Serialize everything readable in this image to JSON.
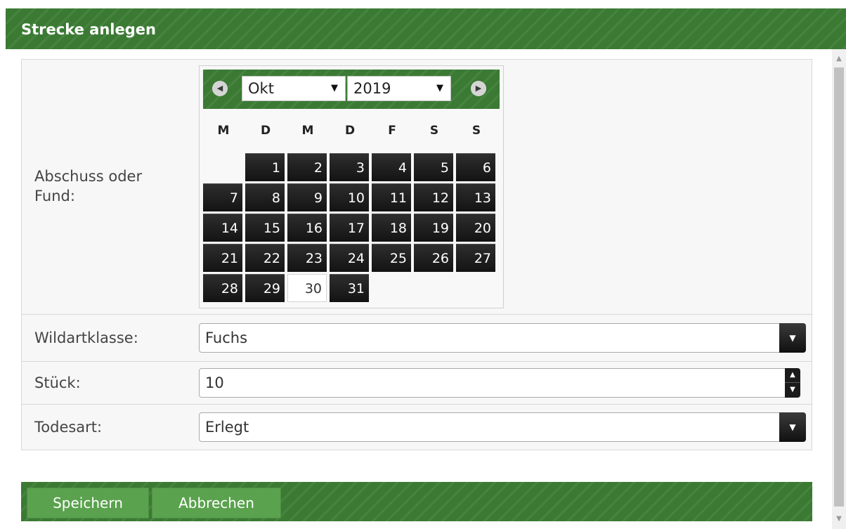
{
  "header": {
    "title": "Strecke anlegen"
  },
  "form": {
    "date_label": "Abschuss oder Fund:",
    "species_label": "Wildartklasse:",
    "species_value": "Fuchs",
    "count_label": "Stück:",
    "count_value": "10",
    "death_label": "Todesart:",
    "death_value": "Erlegt"
  },
  "calendar": {
    "month": "Okt",
    "year": "2019",
    "weekdays": [
      "M",
      "D",
      "M",
      "D",
      "F",
      "S",
      "S"
    ],
    "first_weekday_offset": 1,
    "days": [
      "1",
      "2",
      "3",
      "4",
      "5",
      "6",
      "7",
      "8",
      "9",
      "10",
      "11",
      "12",
      "13",
      "14",
      "15",
      "16",
      "17",
      "18",
      "19",
      "20",
      "21",
      "22",
      "23",
      "24",
      "25",
      "26",
      "27",
      "28",
      "29",
      "30",
      "31"
    ],
    "selected_day": "30"
  },
  "footer": {
    "save_label": "Speichern",
    "cancel_label": "Abbrechen"
  },
  "colors": {
    "brand_green": "#3a7a33",
    "button_green": "#5aa24e",
    "day_cell": "#1f1f1f"
  },
  "icons": {
    "prev": "chevron-left-icon",
    "next": "chevron-right-icon",
    "dropdown": "caret-down-icon"
  }
}
